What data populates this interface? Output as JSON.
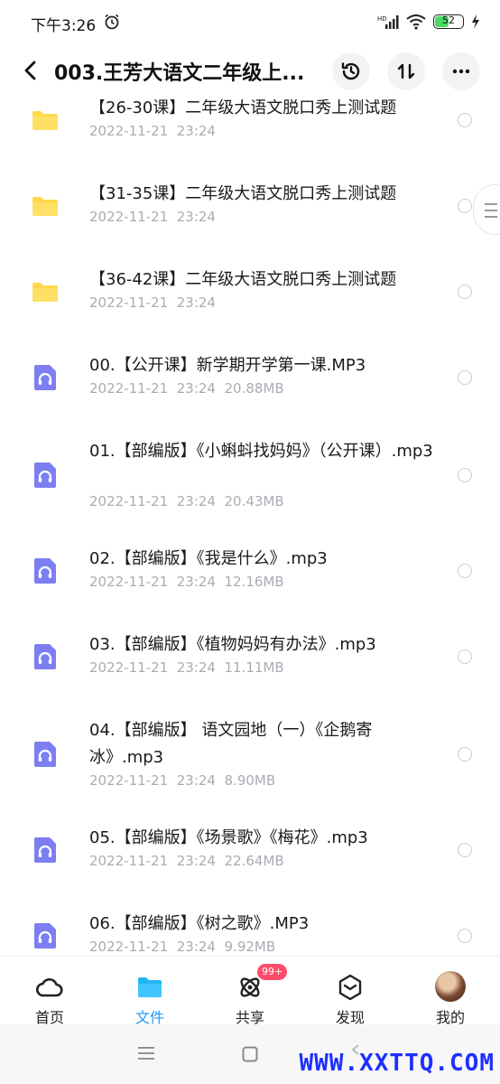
{
  "status_bar": {
    "time": "下午3:26",
    "battery_level": 52,
    "battery_label": "52",
    "signal_label": "HD"
  },
  "header": {
    "title": "003.王芳大语文二年级上...",
    "back_icon": "chevron-left-icon",
    "history_icon": "history-icon",
    "sort_icon": "sort-icon",
    "more_icon": "more-icon"
  },
  "colors": {
    "folder": "#ffd84d",
    "audio": "#7c7ef2",
    "active_tab": "#1e9bf0",
    "badge": "#ff4d6a",
    "watermark": "#1e2fff"
  },
  "files": [
    {
      "type": "folder",
      "name": "【26-30课】二年级大语文脱口秀上测试题",
      "date": "2022-11-21",
      "time": "23:24",
      "size": ""
    },
    {
      "type": "folder",
      "name": "【31-35课】二年级大语文脱口秀上测试题",
      "date": "2022-11-21",
      "time": "23:24",
      "size": ""
    },
    {
      "type": "folder",
      "name": "【36-42课】二年级大语文脱口秀上测试题",
      "date": "2022-11-21",
      "time": "23:24",
      "size": ""
    },
    {
      "type": "audio",
      "name": "00.【公开课】新学期开学第一课.MP3",
      "date": "2022-11-21",
      "time": "23:24",
      "size": "20.88MB"
    },
    {
      "type": "audio",
      "name": "01.【部编版】《小蝌蚪找妈妈》（公开课）.mp3",
      "date": "2022-11-21",
      "time": "23:24",
      "size": "20.43MB"
    },
    {
      "type": "audio",
      "name": "02.【部编版】《我是什么》.mp3",
      "date": "2022-11-21",
      "time": "23:24",
      "size": "12.16MB"
    },
    {
      "type": "audio",
      "name": "03.【部编版】《植物妈妈有办法》.mp3",
      "date": "2022-11-21",
      "time": "23:24",
      "size": "11.11MB"
    },
    {
      "type": "audio",
      "name": "04.【部编版】 语文园地（一）《企鹅寄冰》.mp3",
      "date": "2022-11-21",
      "time": "23:24",
      "size": "8.90MB"
    },
    {
      "type": "audio",
      "name": "05.【部编版】《场景歌》《梅花》.mp3",
      "date": "2022-11-21",
      "time": "23:24",
      "size": "22.64MB"
    },
    {
      "type": "audio",
      "name": "06.【部编版】《树之歌》.MP3",
      "date": "2022-11-21",
      "time": "23:24",
      "size": "9.92MB"
    }
  ],
  "bottom_nav": [
    {
      "label": "首页",
      "icon": "home-cloud-icon",
      "active": false
    },
    {
      "label": "文件",
      "icon": "folder-icon",
      "active": true
    },
    {
      "label": "共享",
      "icon": "share-orbit-icon",
      "active": false,
      "badge": "99+"
    },
    {
      "label": "发现",
      "icon": "discover-cube-icon",
      "active": false
    },
    {
      "label": "我的",
      "icon": "avatar",
      "active": false
    }
  ],
  "system_nav": {
    "menu_icon": "menu-icon",
    "home_icon": "home-square-icon",
    "back_icon": "back-icon"
  },
  "watermark": "WWW.XXTTQ.COM"
}
